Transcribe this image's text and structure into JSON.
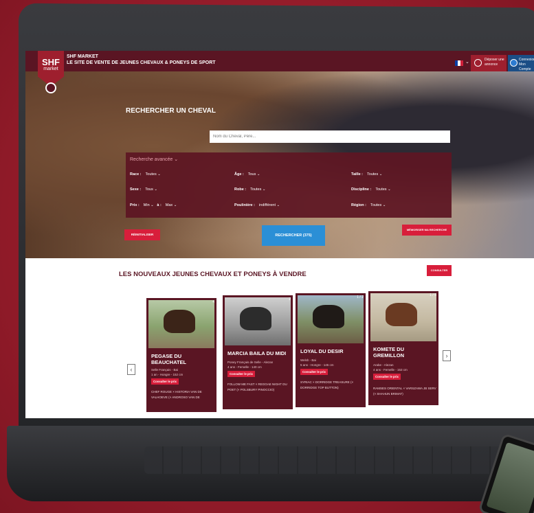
{
  "brand": {
    "logo_top": "SHF",
    "logo_bottom": "market",
    "name": "SHF MARKET",
    "tagline": "LE SITE DE VENTE DE JEUNES CHEVAUX & PONEYS DE SPORT"
  },
  "header": {
    "deposit_label": "Déposer une annonce",
    "login_label": "Connexion Mon Compte",
    "flag_caret": "⌄"
  },
  "search": {
    "title": "RECHERCHER UN CHEVAL",
    "placeholder": "Nom du Cheval, Père..."
  },
  "filters": {
    "advanced_label": "Recherche avancée ⌄",
    "fields": [
      {
        "label": "Race :",
        "value": "Toutes ⌄"
      },
      {
        "label": "Sexe :",
        "value": "Tous ⌄"
      },
      {
        "label": "Prix :",
        "value": "Min ⌄",
        "label2": "à :",
        "value2": "Max ⌄"
      },
      {
        "label": "Âge :",
        "value": "Tous ⌄"
      },
      {
        "label": "Robe :",
        "value": "Toutes ⌄"
      },
      {
        "label": "Poulinière :",
        "value": "indifférent ⌄"
      },
      {
        "label": "Taille :",
        "value": "Toutes ⌄"
      },
      {
        "label": "Discipline :",
        "value": "Toutes ⌄"
      },
      {
        "label": "Région :",
        "value": "Toutes ⌄"
      }
    ],
    "reset_label": "RÉINITIALISER",
    "search_label": "RECHERCHER (375)",
    "save_label": "MÉMORISER MA RECHERCHE"
  },
  "listing": {
    "title": "LES NOUVEAUX JEUNES CHEVAUX ET PONEYS À VENDRE",
    "consult_label": "CONSULTER",
    "prev": "‹",
    "next": "›",
    "price_label": "Consulter le prix",
    "cards": [
      {
        "count": "4",
        "name": "PEGASE DU BEAUCHATEL",
        "breed": "Selle Français - Bai",
        "info": "1 an - Hongre - 152 cm",
        "pedigree": "CHEF ROUGE × HISTORIA VAN DE VALHOEVE (× ANDROSO VAN DE"
      },
      {
        "count": "2",
        "name": "MARCIA BAILA DU MIDI",
        "breed": "Poney Français de Selle - Alezan",
        "info": "4 ans - Femelle - 140 cm",
        "pedigree": "FOLLOW ME FAST × REGGAE NIGHT DU POET (× POLSBURY PINOCCIO)"
      },
      {
        "count": "1 / 2",
        "name": "LOYAL DU DESIR",
        "breed": "Welsh - Bai",
        "info": "5 ans - Hongre - 145 cm",
        "pedigree": "SYRIAC × DORRIDGE TREASURE (× DORRIDGE TOP BUTTON)"
      },
      {
        "count": "1 / 5",
        "name": "KOMETE DU GREMILLON",
        "breed": "Arabe - Alezan",
        "info": "4 ans - Femelle - 153 cm",
        "pedigree": "RAMSES ORIENTAL × VARSZAWA JB SERV (× SHAHUN BRIMAT)"
      }
    ]
  },
  "colors": {
    "background": "#9e1f2e",
    "topbar": "#5a1523",
    "accent_red": "#d81e3b",
    "accent_blue": "#2b8fd6"
  }
}
